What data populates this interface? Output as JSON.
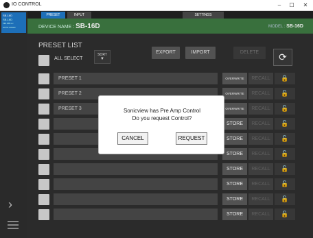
{
  "window": {
    "title": "IO CONTROL",
    "min": "–",
    "max": "☐",
    "close": "✕"
  },
  "rail": {
    "device_card": {
      "line1": "SB-16D",
      "line2": "SB-16D",
      "line3": "192.168.x.x",
      "line4": "AUTO LOGIN"
    },
    "expand_glyph": "›"
  },
  "tabs": {
    "preset": "PRESET",
    "input": "INPUT",
    "settings": "SETTINGS"
  },
  "device_bar": {
    "label": "DEVICE NAME :",
    "name": "SB-16D",
    "model_label": "MODEL :",
    "model": "SB-16D"
  },
  "preset_list": {
    "title": "PRESET LIST",
    "all_select": "ALL SELECT",
    "sort": "SORT",
    "sort_glyph": "▼",
    "export": "EXPORT",
    "import": "IMPORT",
    "delete": "DELETE",
    "refresh_glyph": "⟳",
    "rows": [
      {
        "name": "PRESET 1",
        "action": "OVERWRITE",
        "recall": "RECALL",
        "lock": "🔒"
      },
      {
        "name": "PRESET 2",
        "action": "OVERWRITE",
        "recall": "RECALL",
        "lock": "🔓"
      },
      {
        "name": "PRESET 3",
        "action": "OVERWRITE",
        "recall": "RECALL",
        "lock": "🔓"
      },
      {
        "name": "",
        "action": "STORE",
        "recall": "RECALL",
        "lock": "🔓"
      },
      {
        "name": "",
        "action": "STORE",
        "recall": "RECALL",
        "lock": "🔓"
      },
      {
        "name": "",
        "action": "STORE",
        "recall": "RECALL",
        "lock": "🔓"
      },
      {
        "name": "",
        "action": "STORE",
        "recall": "RECALL",
        "lock": "🔓"
      },
      {
        "name": "",
        "action": "STORE",
        "recall": "RECALL",
        "lock": "🔓"
      },
      {
        "name": "",
        "action": "STORE",
        "recall": "RECALL",
        "lock": "🔓"
      },
      {
        "name": "",
        "action": "STORE",
        "recall": "RECALL",
        "lock": "🔓"
      }
    ]
  },
  "dialog": {
    "line1": "Sonicview has Pre Amp Control",
    "line2": "Do you request Control?",
    "cancel": "CANCEL",
    "request": "REQUEST"
  },
  "colors": {
    "accent_blue": "#1d6fb8",
    "device_bar_green": "#3e7a43",
    "lock_yellow": "#e0b020"
  }
}
